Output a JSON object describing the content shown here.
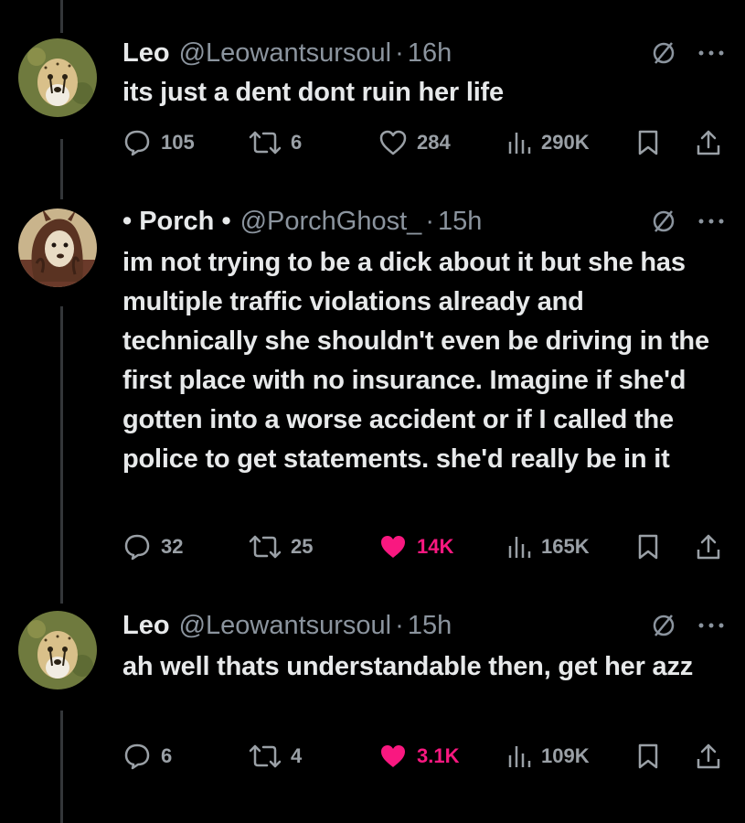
{
  "tweets": [
    {
      "name": "Leo",
      "handle": "@Leowantsursoul",
      "time": "16h",
      "text": "its just a dent dont ruin her life",
      "replies": "105",
      "reposts": "6",
      "likes": "284",
      "liked": false,
      "views": "290K",
      "avatar": "cheetah-avatar"
    },
    {
      "name": "• Porch •",
      "handle": "@PorchGhost_",
      "time": "15h",
      "text": "im not trying to be a dick about it but she has multiple traffic violations already and technically she shouldn't even be driving in the first place with no insurance. Imagine if she'd gotten into a worse accident or if I called the police to get statements. she'd really be in it",
      "replies": "32",
      "reposts": "25",
      "likes": "14K",
      "liked": true,
      "views": "165K",
      "avatar": "furry-avatar"
    },
    {
      "name": "Leo",
      "handle": "@Leowantsursoul",
      "time": "15h",
      "text": "ah well thats understandable then, get her azz",
      "replies": "6",
      "reposts": "4",
      "likes": "3.1K",
      "liked": true,
      "views": "109K",
      "avatar": "cheetah-avatar"
    }
  ],
  "colors": {
    "like_active": "#f91880",
    "muted": "#9aa0a6",
    "text": "#e7e9ea"
  },
  "separator": "·"
}
